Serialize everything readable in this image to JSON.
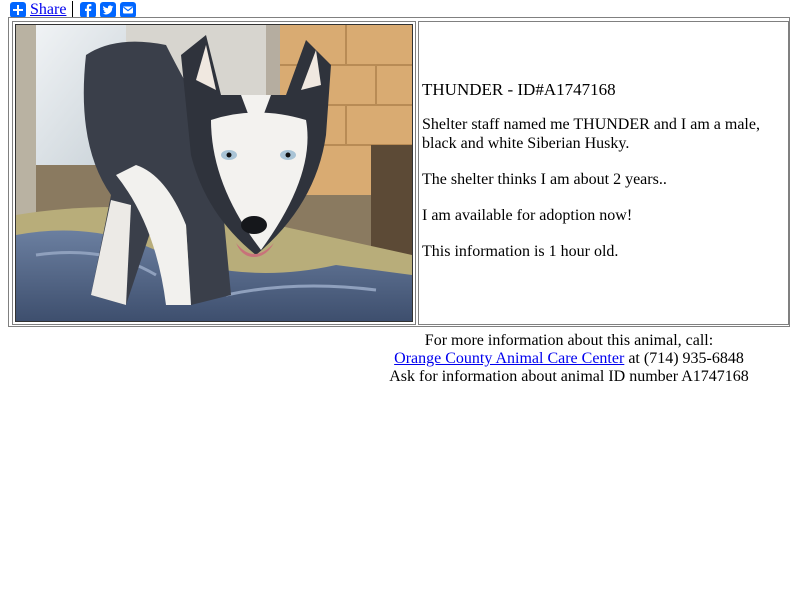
{
  "share": {
    "label": "Share",
    "icons": [
      "addthis-plus-icon",
      "facebook-icon",
      "twitter-icon",
      "email-icon"
    ]
  },
  "animal": {
    "title": "THUNDER - ID#A1747168",
    "desc1": "Shelter staff named me THUNDER and I am a male, black and white Siberian Husky.",
    "desc2": "The shelter thinks I am about 2 years..",
    "desc3": "I am available for adoption now!",
    "desc4": "This information is 1 hour old."
  },
  "contact": {
    "line1": "For more information about this animal, call:",
    "shelter_name": "Orange County Animal Care Center",
    "at_phone": " at (714) 935-6848",
    "line3": "Ask for information about animal ID number A1747168"
  },
  "colors": {
    "share_icon": "#0166ff",
    "link": "#0000ee"
  }
}
